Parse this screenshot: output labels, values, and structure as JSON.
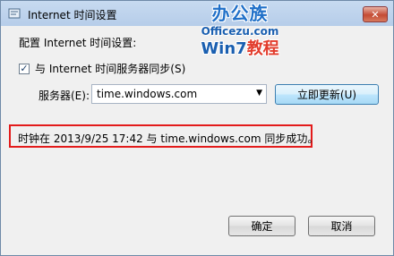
{
  "window": {
    "title": "Internet 时间设置",
    "close_label": "✕"
  },
  "watermark": {
    "line1": "办公族",
    "line2": "Officezu.com",
    "line3_prefix": "Win7",
    "line3_suffix": "教程"
  },
  "config": {
    "heading": "配置 Internet 时间设置:",
    "sync_checkbox_checked": true,
    "sync_label": "与 Internet 时间服务器同步(S)",
    "server_label": "服务器(E):",
    "server_value": "time.windows.com",
    "update_button": "立即更新(U)"
  },
  "status": {
    "message": "时钟在 2013/9/25 17:42 与 time.windows.com 同步成功。"
  },
  "footer": {
    "ok_button": "确定",
    "cancel_button": "取消"
  },
  "colors": {
    "status_border": "#e31b1b",
    "close_button": "#c44b34",
    "watermark_blue": "#2070c8"
  }
}
